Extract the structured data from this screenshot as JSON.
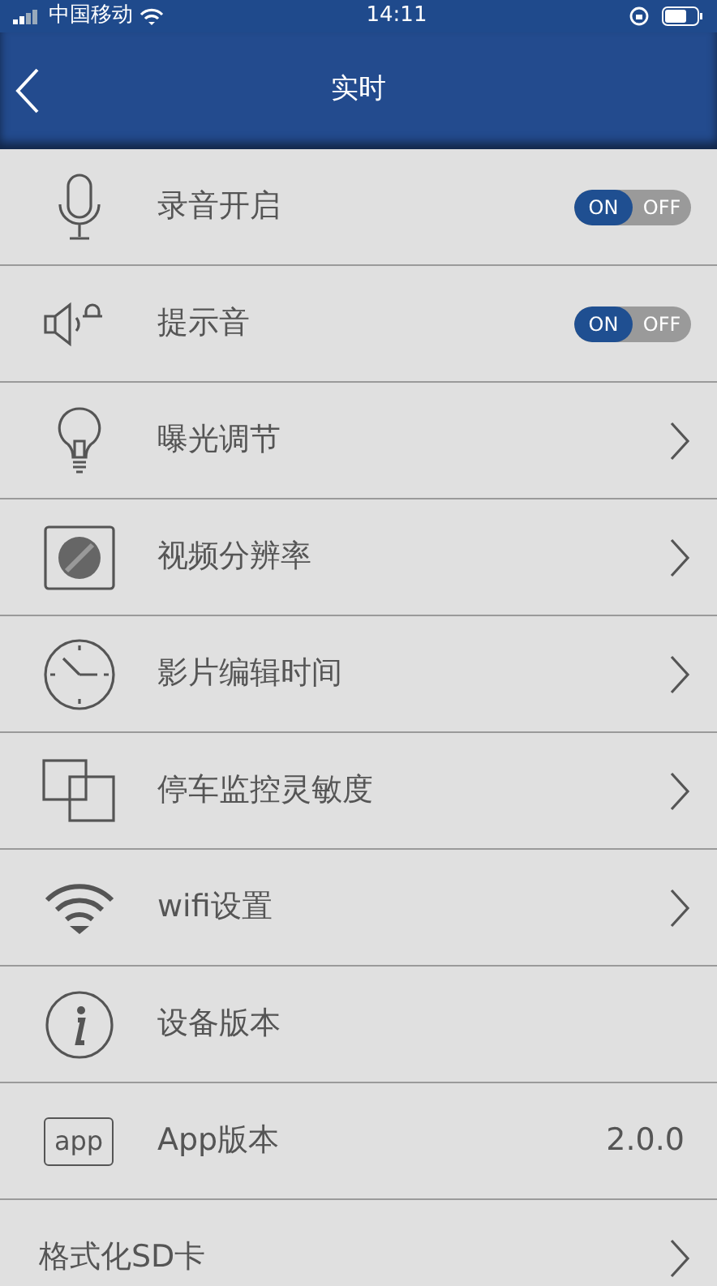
{
  "status_bar": {
    "carrier": "中国移动",
    "time": "14:11"
  },
  "nav": {
    "title": "实时"
  },
  "rows": [
    {
      "kind": "toggle",
      "label": "录音开启",
      "on": true,
      "on_text": "ON",
      "off_text": "OFF"
    },
    {
      "kind": "toggle",
      "label": "提示音",
      "on": true,
      "on_text": "ON",
      "off_text": "OFF"
    },
    {
      "kind": "link",
      "label": "曝光调节"
    },
    {
      "kind": "link",
      "label": "视频分辨率"
    },
    {
      "kind": "link",
      "label": "影片编辑时间"
    },
    {
      "kind": "link",
      "label": "停车监控灵敏度"
    },
    {
      "kind": "link",
      "label": "wifi设置"
    },
    {
      "kind": "plain",
      "label": "设备版本"
    },
    {
      "kind": "value",
      "label": "App版本",
      "icon_text": "app",
      "value": "2.0.0"
    },
    {
      "kind": "link",
      "label": "格式化SD卡"
    }
  ]
}
